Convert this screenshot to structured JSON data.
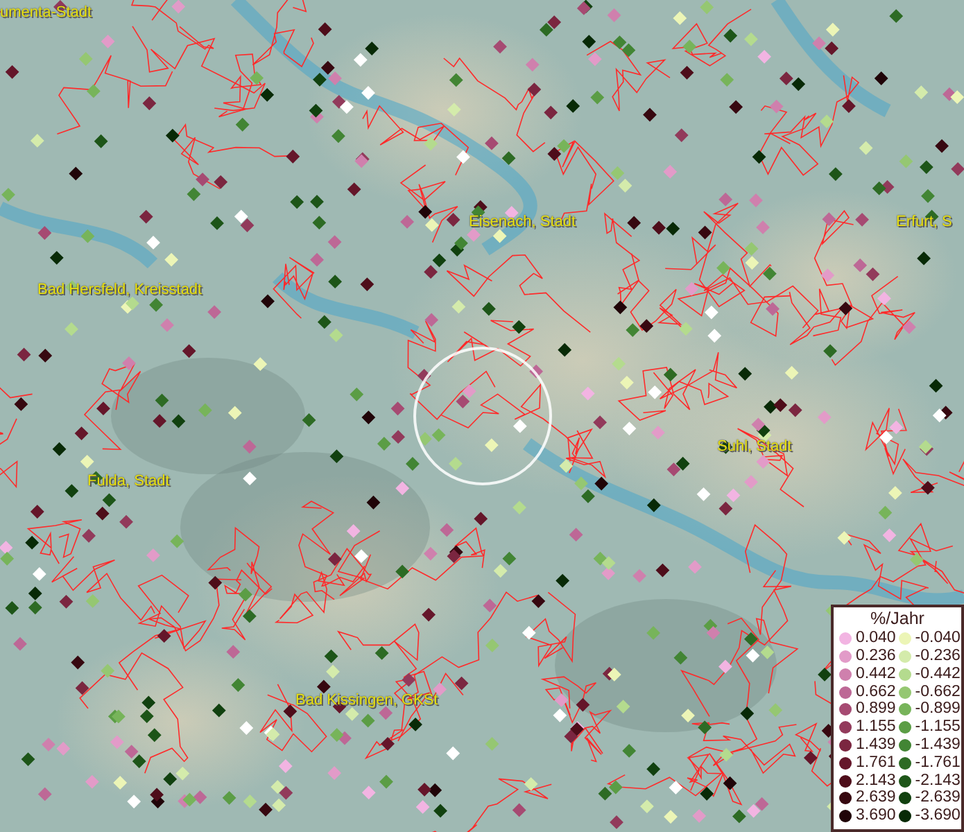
{
  "map": {
    "labels": [
      {
        "text": "umenta-Stadt"
      },
      {
        "text": "Eisenach, Stadt"
      },
      {
        "text": "Erfurt, S"
      },
      {
        "text": "Bad Hersfeld, Kreisstadt"
      },
      {
        "text": "Fulda, Stadt"
      },
      {
        "text": "Suhl, Stadt"
      },
      {
        "text": "Bad Kissingen, GKSt"
      }
    ]
  },
  "legend": {
    "title": "%/Jahr",
    "columns": [
      [
        {
          "value": "0.040",
          "color": "#f2b4e2"
        },
        {
          "value": "0.236",
          "color": "#e29bc8"
        },
        {
          "value": "0.442",
          "color": "#cf80ad"
        },
        {
          "value": "0.662",
          "color": "#bd6896"
        },
        {
          "value": "0.899",
          "color": "#a64a72"
        },
        {
          "value": "1.155",
          "color": "#923a5b"
        },
        {
          "value": "1.439",
          "color": "#7b2640"
        },
        {
          "value": "1.761",
          "color": "#65162a"
        },
        {
          "value": "2.143",
          "color": "#4e0d1a"
        },
        {
          "value": "2.639",
          "color": "#370810"
        },
        {
          "value": "3.690",
          "color": "#200408"
        }
      ],
      [
        {
          "value": "-0.040",
          "color": "#ecf5b6"
        },
        {
          "value": "-0.236",
          "color": "#d4ebab"
        },
        {
          "value": "-0.442",
          "color": "#b4db8e"
        },
        {
          "value": "-0.662",
          "color": "#95c772"
        },
        {
          "value": "-0.899",
          "color": "#77b45a"
        },
        {
          "value": "-1.155",
          "color": "#5b9d45"
        },
        {
          "value": "-1.439",
          "color": "#428534"
        },
        {
          "value": "-1.761",
          "color": "#2d6b24"
        },
        {
          "value": "-2.143",
          "color": "#1d5518"
        },
        {
          "value": "-2.639",
          "color": "#11410f"
        },
        {
          "value": "-3.690",
          "color": "#082a06"
        }
      ]
    ]
  }
}
